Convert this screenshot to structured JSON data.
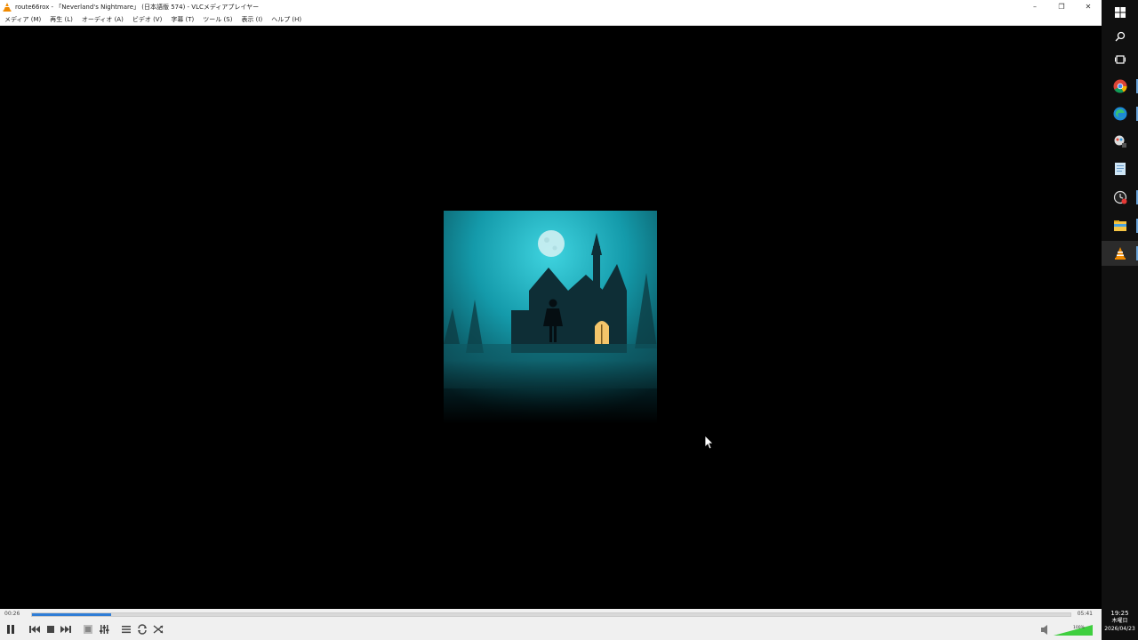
{
  "window": {
    "title": "route66rox - 「Neverland's Nightmare」 (日本語版 574) - VLCメディアプレイヤー",
    "controls": {
      "minimize": "–",
      "restore": "❐",
      "close": "✕"
    }
  },
  "menu": [
    "メディア (M)",
    "再生 (L)",
    "オーディオ (A)",
    "ビデオ (V)",
    "字幕 (T)",
    "ツール (S)",
    "表示 (I)",
    "ヘルプ (H)"
  ],
  "player": {
    "time_current": "00:26",
    "time_total": "05:41",
    "progress_fraction": 0.076,
    "volume_percent": "100%",
    "buttons": [
      "pause-icon",
      "prev-icon",
      "stop-icon",
      "next-icon",
      "fullscreen-icon",
      "extended-settings-icon",
      "playlist-icon",
      "loop-icon",
      "shuffle-icon"
    ]
  },
  "colors": {
    "accent": "#2f7dd6",
    "volume": "#3fcf3f",
    "art_teal": "#1fa8b8"
  },
  "taskbar": {
    "icons": [
      "windows-start-icon",
      "search-icon",
      "task-view-icon",
      "chrome-icon",
      "edge-icon",
      "app-icon",
      "notepad-icon",
      "clock-app-icon",
      "file-explorer-icon",
      "vlc-icon"
    ],
    "clock": {
      "time": "19:25",
      "weekday": "木曜日",
      "date": "2026/04/23"
    }
  }
}
